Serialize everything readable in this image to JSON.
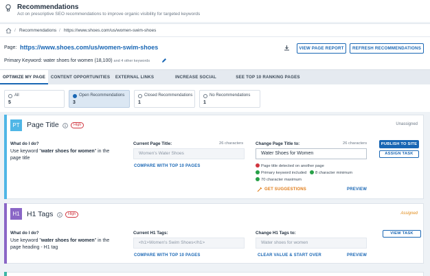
{
  "header": {
    "title": "Recommendations",
    "subtitle": "Act on prescriptive SEO recommendations to improve organic visibility for targeted keywords"
  },
  "breadcrumb": {
    "sep1": "/",
    "item1": "Recommendations",
    "sep2": "/",
    "item2": "https://www.shoes.com/us/women-swim-shoes"
  },
  "page": {
    "label": "Page:",
    "url": "https://www.shoes.com/us/women-swim-shoes",
    "keyword_prefix": "Primary Keyword: ",
    "keyword": "water shoes for women (18,100)",
    "other_keywords": "and 4 other keywords",
    "view_report": "VIEW PAGE REPORT",
    "refresh": "REFRESH RECOMMENDATIONS"
  },
  "tabs": [
    {
      "label": "OPTIMIZE MY PAGE"
    },
    {
      "label": "CONTENT OPPORTUNITIES"
    },
    {
      "label": "EXTERNAL LINKS"
    },
    {
      "label": "INCREASE SOCIAL ENGAGEMENT"
    },
    {
      "label": "SEE TOP 10 RANKING PAGES"
    }
  ],
  "filters": [
    {
      "label": "All",
      "count": "5"
    },
    {
      "label": "Open Recommendations",
      "count": "3"
    },
    {
      "label": "Closed Recommendations",
      "count": "1"
    },
    {
      "label": "No Recommendations",
      "count": "1"
    }
  ],
  "cards": {
    "title_card": {
      "badge": "PT",
      "title": "Page Title",
      "priority": "High",
      "status": "Unassigned",
      "what_label": "What do I do?",
      "desc_prefix": "Use keyword \"",
      "desc_keyword": "water shoes for women",
      "desc_suffix": "\" in the page title",
      "current_label": "Current Page Title:",
      "current_chars": "26 characters",
      "current_value": "Women's Water Shoes",
      "compare_link": "COMPARE WITH TOP 10 PAGES",
      "change_label": "Change Page Title to:",
      "change_chars": "26 characters",
      "change_value": "Water Shoes for Women",
      "checks": [
        "Page title detected on another page",
        "Primary keyword included",
        "8 character minimum",
        "70 character maximum"
      ],
      "suggest_link": "GET SUGGESTIONS",
      "preview_link": "PREVIEW",
      "publish": "PUBLISH TO SITE",
      "assign": "ASSIGN TASK"
    },
    "h1_card": {
      "badge": "H1",
      "title": "H1 Tags",
      "priority": "High",
      "status": "Assigned",
      "what_label": "What do I do?",
      "desc_prefix": "Use keyword \"",
      "desc_keyword": "water shoes for women",
      "desc_suffix": "\" in the page heading - H1 tag",
      "current_label": "Current H1 Tags:",
      "current_value": "<h1>Women's Swim Shoes</h1>",
      "compare_link": "COMPARE WITH TOP 10 PAGES",
      "change_label": "Change H1 Tags to:",
      "change_placeholder": "Water shoes for women",
      "clear_link": "CLEAR VALUE & START OVER",
      "preview_link": "PREVIEW",
      "view_task": "VIEW TASK"
    }
  },
  "colors": {
    "accent": "#1866b4",
    "pt_badge": "#4fb6e6",
    "h1_badge": "#8a66c6",
    "danger": "#d0353f",
    "success": "#27a047",
    "orange": "#e07b17",
    "assigned": "#e08a17"
  }
}
